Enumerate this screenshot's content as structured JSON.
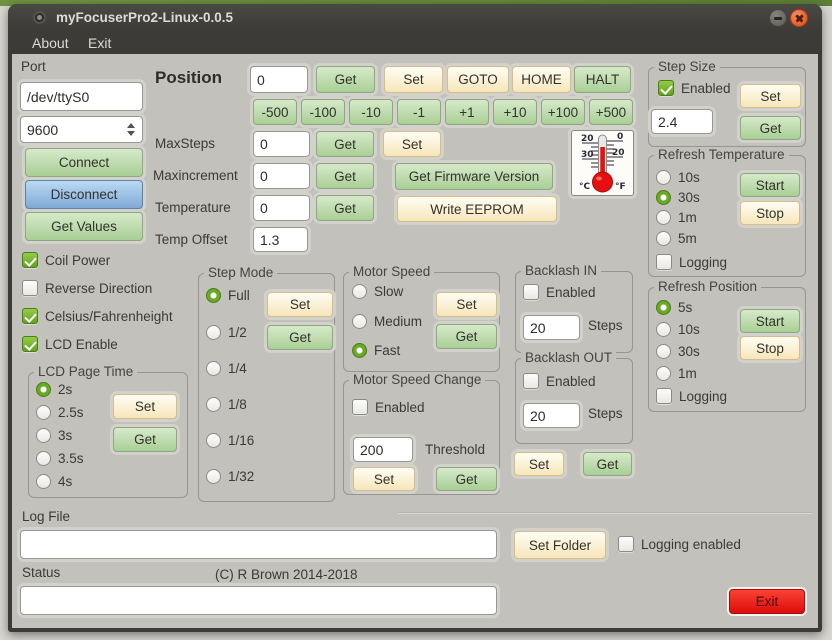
{
  "titlebar": {
    "title": "myFocuserPro2-Linux-0.0.5"
  },
  "menu": {
    "about": "About",
    "exit": "Exit"
  },
  "port": {
    "label": "Port",
    "device": "/dev/ttyS0",
    "baud": "9600",
    "connect": "Connect",
    "disconnect": "Disconnect",
    "get_values": "Get Values"
  },
  "toggles": {
    "coil_power": "Coil Power",
    "reverse_direction": "Reverse Direction",
    "celsius_fahrenheight": "Celsius/Fahrenheight",
    "lcd_enable": "LCD Enable"
  },
  "lcd_page_time": {
    "title": "LCD Page Time",
    "options": [
      "2s",
      "2.5s",
      "3s",
      "3.5s",
      "4s"
    ],
    "selected": "2s",
    "set": "Set",
    "get": "Get"
  },
  "position": {
    "label": "Position",
    "value": "0",
    "get": "Get",
    "set": "Set",
    "goto": "GOTO",
    "home": "HOME",
    "halt": "HALT",
    "steps": [
      "-500",
      "-100",
      "-10",
      "-1",
      "+1",
      "+10",
      "+100",
      "+500"
    ]
  },
  "maxsteps": {
    "label": "MaxSteps",
    "value": "0",
    "get": "Get",
    "set": "Set"
  },
  "maxincrement": {
    "label": "Maxincrement",
    "value": "0",
    "get": "Get"
  },
  "temperature": {
    "label": "Temperature",
    "value": "0",
    "get": "Get"
  },
  "temp_offset": {
    "label": "Temp Offset",
    "value": "1.3"
  },
  "firmware": {
    "get_version": "Get Firmware Version",
    "write_eeprom": "Write EEPROM"
  },
  "thermometer": {
    "left_ticks": [
      "20",
      "30"
    ],
    "right_ticks": [
      "0",
      "20"
    ],
    "left_unit": "°C",
    "right_unit": "°F"
  },
  "step_size": {
    "title": "Step Size",
    "enabled": "Enabled",
    "value": "2.4",
    "set": "Set",
    "get": "Get"
  },
  "refresh_temperature": {
    "title": "Refresh Temperature",
    "options": [
      "10s",
      "30s",
      "1m",
      "5m"
    ],
    "selected": "30s",
    "logging": "Logging",
    "start": "Start",
    "stop": "Stop"
  },
  "refresh_position": {
    "title": "Refresh Position",
    "options": [
      "5s",
      "10s",
      "30s",
      "1m"
    ],
    "selected": "5s",
    "logging": "Logging",
    "start": "Start",
    "stop": "Stop"
  },
  "step_mode": {
    "title": "Step Mode",
    "options": [
      "Full",
      "1/2",
      "1/4",
      "1/8",
      "1/16",
      "1/32"
    ],
    "selected": "Full",
    "set": "Set",
    "get": "Get"
  },
  "motor_speed": {
    "title": "Motor Speed",
    "options": [
      "Slow",
      "Medium",
      "Fast"
    ],
    "selected": "Fast",
    "set": "Set",
    "get": "Get"
  },
  "motor_speed_change": {
    "title": "Motor Speed Change",
    "enabled": "Enabled",
    "threshold_value": "200",
    "threshold_label": "Threshold",
    "set": "Set",
    "get": "Get"
  },
  "backlash_in": {
    "title": "Backlash IN",
    "enabled": "Enabled",
    "value": "20",
    "steps_label": "Steps"
  },
  "backlash_out": {
    "title": "Backlash OUT",
    "enabled": "Enabled",
    "value": "20",
    "steps_label": "Steps"
  },
  "backlash_actions": {
    "set": "Set",
    "get": "Get"
  },
  "log_file": {
    "label": "Log File",
    "value": "",
    "set_folder": "Set Folder",
    "logging_enabled": "Logging enabled"
  },
  "status": {
    "label": "Status",
    "value": "",
    "copyright": "(C) R Brown 2014-2018"
  },
  "exit_label": "Exit",
  "colors": {
    "titlebar": "#3c3b37",
    "body": "#c2c1bc",
    "green_button": "#a9cf96",
    "cream_button": "#f6e6ba",
    "blue_button": "#7fa9d6",
    "red_button": "#dd0c0c",
    "check_green": "#62a31f"
  }
}
